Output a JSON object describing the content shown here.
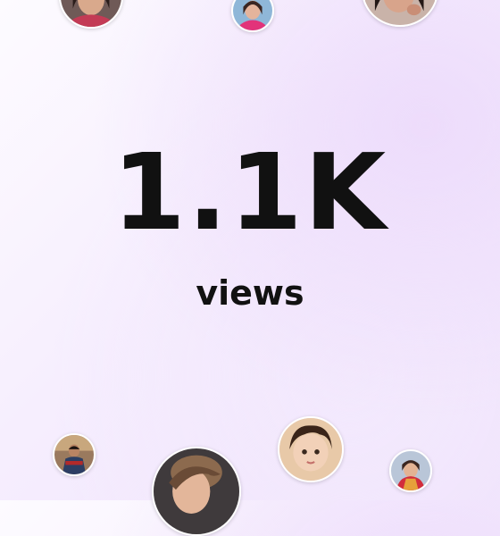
{
  "stats": {
    "views_count": "1.1K",
    "views_label": "views"
  },
  "colors": {
    "text": "#111111",
    "background_start": "#fdfbff",
    "background_end": "#efe2fc"
  },
  "avatars": [
    {
      "icon": "viewer-avatar"
    },
    {
      "icon": "viewer-avatar"
    },
    {
      "icon": "viewer-avatar"
    },
    {
      "icon": "viewer-avatar"
    },
    {
      "icon": "viewer-avatar"
    },
    {
      "icon": "viewer-avatar"
    },
    {
      "icon": "viewer-avatar"
    }
  ]
}
